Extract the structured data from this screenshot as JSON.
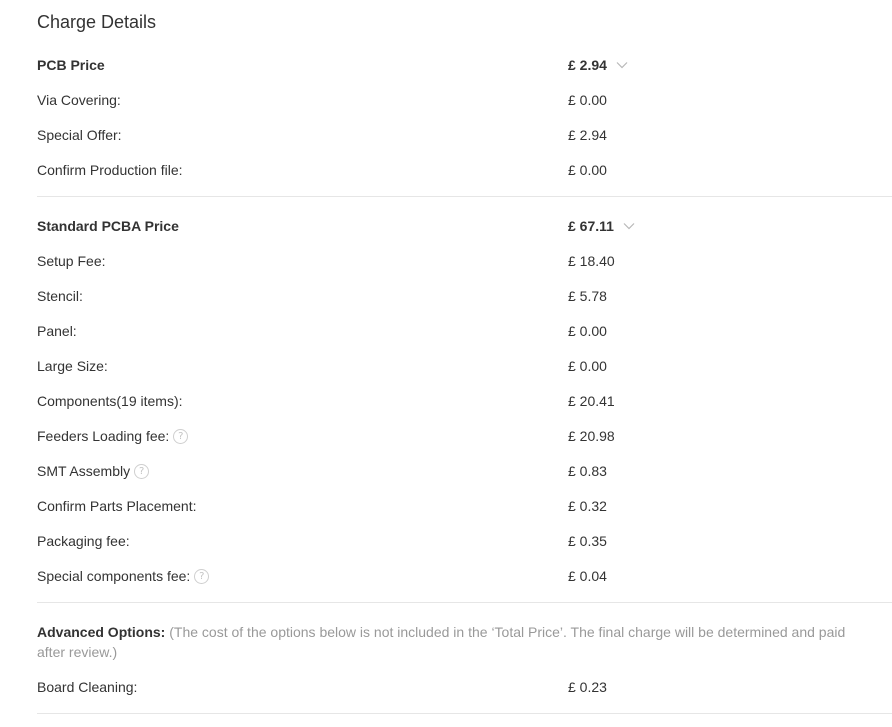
{
  "title": "Charge Details",
  "pcb": {
    "label": "PCB Price",
    "value": "£ 2.94",
    "items": [
      {
        "label": "Via Covering:",
        "value": "£ 0.00"
      },
      {
        "label": "Special Offer:",
        "value": "£ 2.94"
      },
      {
        "label": "Confirm Production file:",
        "value": "£ 0.00"
      }
    ]
  },
  "pcba": {
    "label": "Standard PCBA Price",
    "value": "£ 67.11",
    "items": [
      {
        "label": "Setup Fee:",
        "value": "£ 18.40"
      },
      {
        "label": "Stencil:",
        "value": "£ 5.78"
      },
      {
        "label": "Panel:",
        "value": "£ 0.00"
      },
      {
        "label": "Large Size:",
        "value": "£ 0.00"
      },
      {
        "label": "Components(19 items):",
        "value": "£ 20.41"
      },
      {
        "label": "Feeders Loading fee:",
        "value": "£ 20.98"
      },
      {
        "label": "SMT Assembly",
        "value": "£ 0.83"
      },
      {
        "label": "Confirm Parts Placement:",
        "value": "£ 0.32"
      },
      {
        "label": "Packaging fee:",
        "value": "£ 0.35"
      },
      {
        "label": "Special components fee:",
        "value": "£ 0.04"
      }
    ]
  },
  "advanced": {
    "label": "Advanced Options:",
    "note": "(The cost of the options below is not included in the ‘Total Price’. The final charge will be determined and paid after review.)",
    "items": [
      {
        "label": "Board Cleaning:",
        "value": "£ 0.23"
      }
    ]
  },
  "icons": {
    "help": "question-mark-circle-icon",
    "expand": "chevron-down-icon"
  }
}
